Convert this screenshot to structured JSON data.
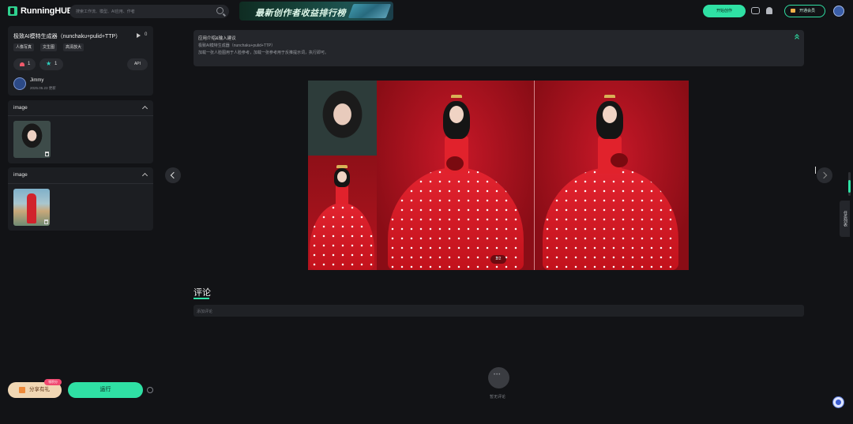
{
  "header": {
    "logo_text": "RunningHUB",
    "search_placeholder": "搜索工作流、模型、AI应用、作者",
    "banner_text": "最新创作者收益排行榜",
    "create_button": "开始创作",
    "vip_button": "开通会员"
  },
  "workflow": {
    "title": "极致AI模特生成器（nunchaku+pulid+TTP）",
    "play_count": "0",
    "tags": [
      "人像写真",
      "文生图",
      "高清放大"
    ],
    "likes": "1",
    "stars": "1",
    "api_label": "API",
    "author": "Jimmy",
    "updated": "2025.05.23 更新"
  },
  "inputs": [
    {
      "section_title": "image"
    },
    {
      "section_title": "image"
    }
  ],
  "footer_left": {
    "share_label": "分享有礼",
    "share_badge": "领积分",
    "run_label": "运行"
  },
  "intro": {
    "title": "应用介绍&输入建议",
    "lines": [
      "极致AI模特生成器（nunchaku+pulid+TTP）",
      "加载一张人脸图用于人脸参考，加载一张参考用于反推提示词，执行即可。"
    ]
  },
  "gallery": {
    "counter": "2/2"
  },
  "comments": {
    "title": "评论",
    "placeholder": "添加评论",
    "empty_text": "暂无评论"
  },
  "side_tab": "任务列表",
  "colors": {
    "accent": "#2fe0a4",
    "background": "#121316",
    "panel": "#1c1e22"
  }
}
